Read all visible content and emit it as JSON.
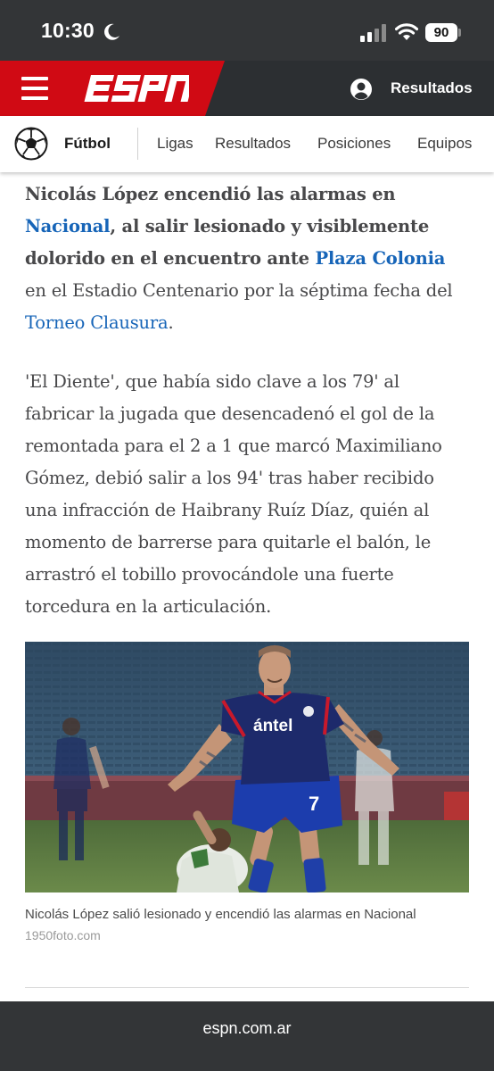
{
  "status_bar": {
    "time": "10:30",
    "battery": "90",
    "icons": [
      "moon-icon",
      "signal-icon",
      "wifi-icon",
      "battery-icon"
    ]
  },
  "header": {
    "logo": "ESPN",
    "results_label": "Resultados",
    "colors": {
      "brand_red": "#d00a14",
      "header_dark": "#2c2f32"
    },
    "icons": [
      "hamburger-menu-icon",
      "user-account-icon"
    ]
  },
  "sub_nav": {
    "sport": "Fútbol",
    "links": [
      "Ligas",
      "Resultados",
      "Posiciones",
      "Equipos"
    ],
    "icons": [
      "soccer-ball-icon"
    ]
  },
  "article": {
    "lead": {
      "t1": "Nicolás López encendió las alarmas en ",
      "link1": "Nacional",
      "t2": ", al salir lesionado y visiblemente dolorido en el encuentro ante ",
      "link2": "Plaza Colonia",
      "t3": " en el Estadio Centenario por la séptima fecha del ",
      "link3": "Torneo Clausura",
      "t4": "."
    },
    "body": "'El Diente', que había sido clave a los 79' al fabricar la jugada que desencadenó el gol de la remontada para el 2 a 1 que marcó Maximiliano Gómez, debió salir a los 94' tras haber recibido una infracción de Haibrany Ruíz Díaz, quién al momento de barrerse para quitarle el balón, le arrastró el tobillo provocándole una fuerte torcedura en la articulación.",
    "link_color": "#1765b8",
    "photo": {
      "jersey_sponsor": "ántel",
      "jersey_number": "7",
      "caption": "Nicolás López salió lesionado y encendió las alarmas en Nacional",
      "credit": "1950foto.com"
    }
  },
  "browser": {
    "url": "espn.com.ar"
  }
}
